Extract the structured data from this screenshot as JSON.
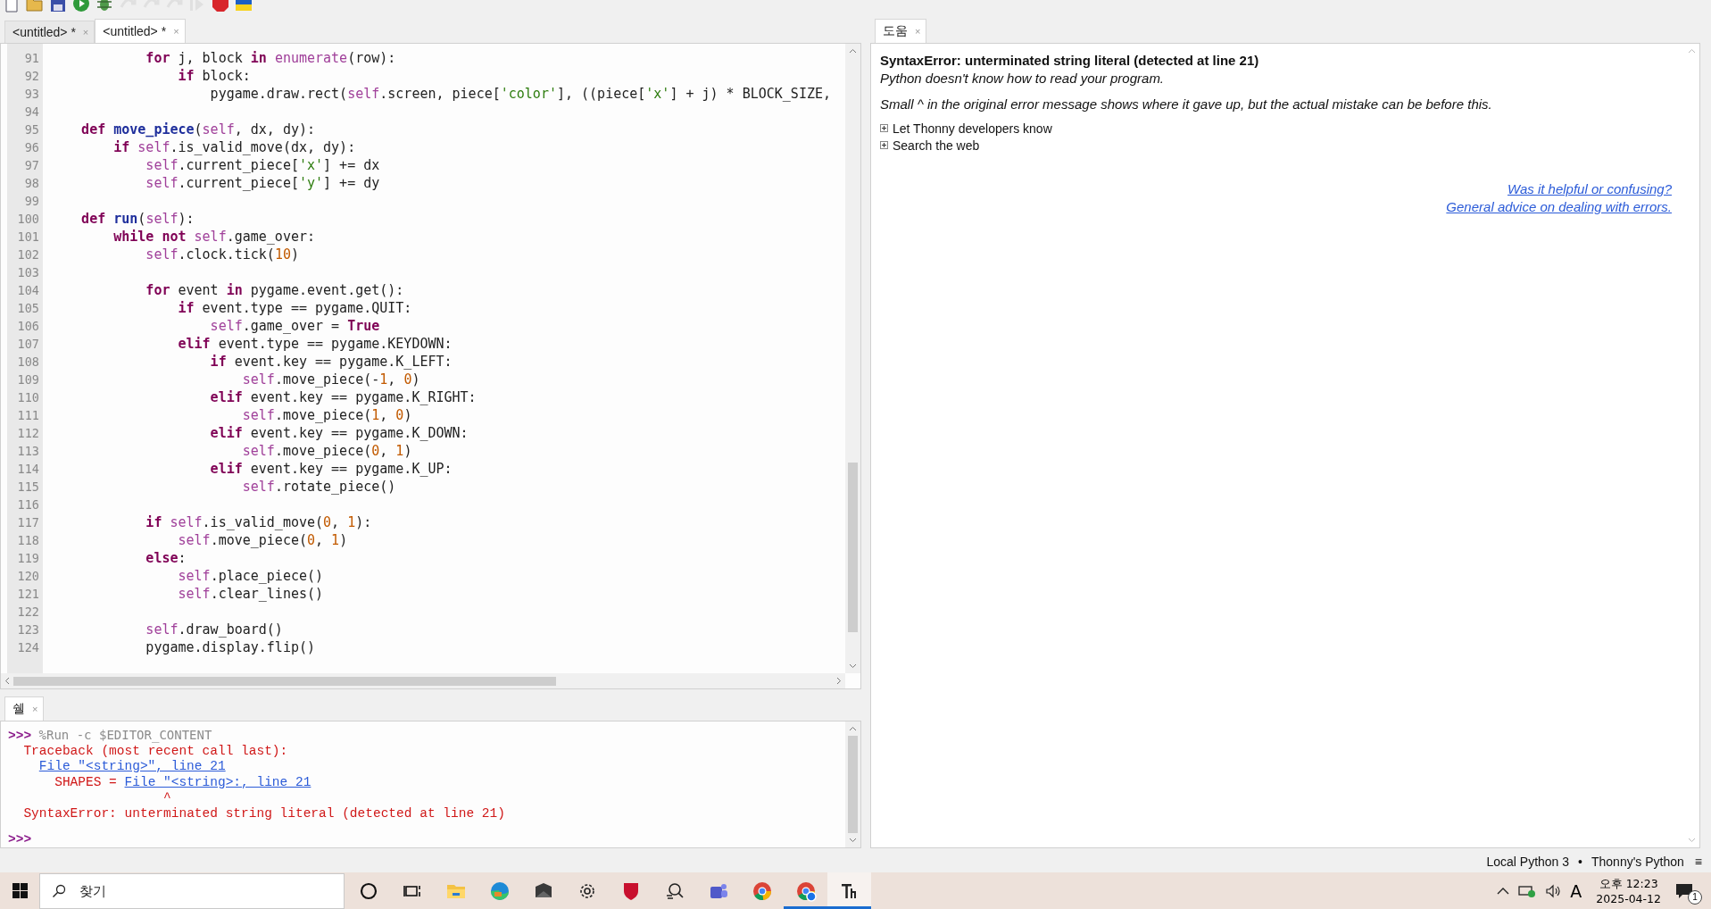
{
  "toolbar": {
    "buttons": [
      {
        "kind": "new",
        "disabled": false
      },
      {
        "kind": "open",
        "disabled": false
      },
      {
        "kind": "save",
        "disabled": false
      },
      {
        "kind": "run",
        "disabled": false
      },
      {
        "kind": "debug",
        "disabled": false
      },
      {
        "kind": "step_over",
        "disabled": true
      },
      {
        "kind": "step_into",
        "disabled": true
      },
      {
        "kind": "step_out",
        "disabled": true
      },
      {
        "kind": "resume",
        "disabled": true
      },
      {
        "kind": "stop",
        "disabled": false
      },
      {
        "kind": "flag",
        "disabled": false
      }
    ]
  },
  "editor": {
    "tabs": [
      {
        "label": "<untitled>",
        "marker": "*",
        "close": "×",
        "selected": false
      },
      {
        "label": "<untitled>",
        "marker": "*",
        "close": "×",
        "selected": true
      }
    ],
    "lines": [
      {
        "no": "91",
        "tokens": [
          {
            "kind": "kw",
            "text": "            for"
          },
          {
            "kind": "plain",
            "text": " j, block "
          },
          {
            "kind": "kw",
            "text": "in "
          },
          {
            "kind": "builtin",
            "text": "enumerate"
          },
          {
            "kind": "plain",
            "text": "(row):"
          }
        ]
      },
      {
        "no": "92",
        "tokens": [
          {
            "kind": "kw",
            "text": "                if"
          },
          {
            "kind": "plain",
            "text": " block:"
          }
        ]
      },
      {
        "no": "93",
        "tokens": [
          {
            "kind": "plain",
            "text": "                    pygame.draw.rect("
          },
          {
            "kind": "builtin",
            "text": "self"
          },
          {
            "kind": "plain",
            "text": ".screen, piece["
          },
          {
            "kind": "str",
            "text": "'color'"
          },
          {
            "kind": "plain",
            "text": "], ((piece["
          },
          {
            "kind": "str",
            "text": "'x'"
          },
          {
            "kind": "plain",
            "text": "] + j) * BLOCK_SIZE,"
          }
        ]
      },
      {
        "no": "94"
      },
      {
        "no": "95",
        "tokens": [
          {
            "kind": "kw",
            "text": "    def "
          },
          {
            "kind": "defname",
            "text": "move_piece"
          },
          {
            "kind": "plain",
            "text": "("
          },
          {
            "kind": "builtin",
            "text": "self"
          },
          {
            "kind": "plain",
            "text": ", dx, dy):"
          }
        ]
      },
      {
        "no": "96",
        "tokens": [
          {
            "kind": "kw",
            "text": "        if "
          },
          {
            "kind": "builtin",
            "text": "self"
          },
          {
            "kind": "plain",
            "text": ".is_valid_move(dx, dy):"
          }
        ]
      },
      {
        "no": "97",
        "tokens": [
          {
            "kind": "builtin",
            "text": "            self"
          },
          {
            "kind": "plain",
            "text": ".current_piece["
          },
          {
            "kind": "str",
            "text": "'x'"
          },
          {
            "kind": "plain",
            "text": "] += dx"
          }
        ]
      },
      {
        "no": "98",
        "tokens": [
          {
            "kind": "builtin",
            "text": "            self"
          },
          {
            "kind": "plain",
            "text": ".current_piece["
          },
          {
            "kind": "str",
            "text": "'y'"
          },
          {
            "kind": "plain",
            "text": "] += dy"
          }
        ]
      },
      {
        "no": "99"
      },
      {
        "no": "100",
        "tokens": [
          {
            "kind": "kw",
            "text": "    def "
          },
          {
            "kind": "defname",
            "text": "run"
          },
          {
            "kind": "plain",
            "text": "("
          },
          {
            "kind": "builtin",
            "text": "self"
          },
          {
            "kind": "plain",
            "text": "):"
          }
        ]
      },
      {
        "no": "101",
        "tokens": [
          {
            "kind": "kw",
            "text": "        while not "
          },
          {
            "kind": "builtin",
            "text": "self"
          },
          {
            "kind": "plain",
            "text": ".game_over:"
          }
        ]
      },
      {
        "no": "102",
        "tokens": [
          {
            "kind": "builtin",
            "text": "            self"
          },
          {
            "kind": "plain",
            "text": ".clock.tick("
          },
          {
            "kind": "num",
            "text": "10"
          },
          {
            "kind": "plain",
            "text": ")"
          }
        ]
      },
      {
        "no": "103"
      },
      {
        "no": "104",
        "tokens": [
          {
            "kind": "kw",
            "text": "            for"
          },
          {
            "kind": "plain",
            "text": " event "
          },
          {
            "kind": "kw",
            "text": "in"
          },
          {
            "kind": "plain",
            "text": " pygame.event.get():"
          }
        ]
      },
      {
        "no": "105",
        "tokens": [
          {
            "kind": "kw",
            "text": "                if"
          },
          {
            "kind": "plain",
            "text": " event.type == pygame.QUIT:"
          }
        ]
      },
      {
        "no": "106",
        "tokens": [
          {
            "kind": "builtin",
            "text": "                    self"
          },
          {
            "kind": "plain",
            "text": ".game_over = "
          },
          {
            "kind": "kw",
            "text": "True"
          }
        ]
      },
      {
        "no": "107",
        "tokens": [
          {
            "kind": "kw",
            "text": "                elif"
          },
          {
            "kind": "plain",
            "text": " event.type == pygame.KEYDOWN:"
          }
        ]
      },
      {
        "no": "108",
        "tokens": [
          {
            "kind": "kw",
            "text": "                    if"
          },
          {
            "kind": "plain",
            "text": " event.key == pygame.K_LEFT:"
          }
        ]
      },
      {
        "no": "109",
        "tokens": [
          {
            "kind": "builtin",
            "text": "                        self"
          },
          {
            "kind": "plain",
            "text": ".move_piece(-"
          },
          {
            "kind": "num",
            "text": "1"
          },
          {
            "kind": "plain",
            "text": ", "
          },
          {
            "kind": "num",
            "text": "0"
          },
          {
            "kind": "plain",
            "text": ")"
          }
        ]
      },
      {
        "no": "110",
        "tokens": [
          {
            "kind": "kw",
            "text": "                    elif"
          },
          {
            "kind": "plain",
            "text": " event.key == pygame.K_RIGHT:"
          }
        ]
      },
      {
        "no": "111",
        "tokens": [
          {
            "kind": "builtin",
            "text": "                        self"
          },
          {
            "kind": "plain",
            "text": ".move_piece("
          },
          {
            "kind": "num",
            "text": "1"
          },
          {
            "kind": "plain",
            "text": ", "
          },
          {
            "kind": "num",
            "text": "0"
          },
          {
            "kind": "plain",
            "text": ")"
          }
        ]
      },
      {
        "no": "112",
        "tokens": [
          {
            "kind": "kw",
            "text": "                    elif"
          },
          {
            "kind": "plain",
            "text": " event.key == pygame.K_DOWN:"
          }
        ]
      },
      {
        "no": "113",
        "tokens": [
          {
            "kind": "builtin",
            "text": "                        self"
          },
          {
            "kind": "plain",
            "text": ".move_piece("
          },
          {
            "kind": "num",
            "text": "0"
          },
          {
            "kind": "plain",
            "text": ", "
          },
          {
            "kind": "num",
            "text": "1"
          },
          {
            "kind": "plain",
            "text": ")"
          }
        ]
      },
      {
        "no": "114",
        "tokens": [
          {
            "kind": "kw",
            "text": "                    elif"
          },
          {
            "kind": "plain",
            "text": " event.key == pygame.K_UP:"
          }
        ]
      },
      {
        "no": "115",
        "tokens": [
          {
            "kind": "builtin",
            "text": "                        self"
          },
          {
            "kind": "plain",
            "text": ".rotate_piece()"
          }
        ]
      },
      {
        "no": "116"
      },
      {
        "no": "117",
        "tokens": [
          {
            "kind": "kw",
            "text": "            if "
          },
          {
            "kind": "builtin",
            "text": "self"
          },
          {
            "kind": "plain",
            "text": ".is_valid_move("
          },
          {
            "kind": "num",
            "text": "0"
          },
          {
            "kind": "plain",
            "text": ", "
          },
          {
            "kind": "num",
            "text": "1"
          },
          {
            "kind": "plain",
            "text": "):"
          }
        ]
      },
      {
        "no": "118",
        "tokens": [
          {
            "kind": "builtin",
            "text": "                self"
          },
          {
            "kind": "plain",
            "text": ".move_piece("
          },
          {
            "kind": "num",
            "text": "0"
          },
          {
            "kind": "plain",
            "text": ", "
          },
          {
            "kind": "num",
            "text": "1"
          },
          {
            "kind": "plain",
            "text": ")"
          }
        ]
      },
      {
        "no": "119",
        "tokens": [
          {
            "kind": "kw",
            "text": "            else"
          },
          {
            "kind": "plain",
            "text": ":"
          }
        ]
      },
      {
        "no": "120",
        "tokens": [
          {
            "kind": "builtin",
            "text": "                self"
          },
          {
            "kind": "plain",
            "text": ".place_piece()"
          }
        ]
      },
      {
        "no": "121",
        "tokens": [
          {
            "kind": "builtin",
            "text": "                self"
          },
          {
            "kind": "plain",
            "text": ".clear_lines()"
          }
        ]
      },
      {
        "no": "122"
      },
      {
        "no": "123",
        "tokens": [
          {
            "kind": "builtin",
            "text": "            self"
          },
          {
            "kind": "plain",
            "text": ".draw_board()"
          }
        ]
      },
      {
        "no": "124",
        "tokens": [
          {
            "kind": "plain",
            "text": "            pygame.display.flip()"
          }
        ]
      }
    ]
  },
  "shell": {
    "tab": {
      "label": "쉘",
      "close": "×"
    },
    "lines": [
      {
        "parts": [
          {
            "kind": "prompt",
            "text": ">>>"
          },
          {
            "kind": "command",
            "text": " %Run -c $EDITOR_CONTENT"
          }
        ]
      },
      {
        "parts": [
          {
            "kind": "error",
            "text": "  Traceback (most recent call last):"
          }
        ]
      },
      {
        "parts": [
          {
            "kind": "link",
            "text": "File \"<string>\", line 21"
          }
        ]
      },
      {
        "parts": [
          {
            "kind": "error",
            "text": "      SHAPES = "
          },
          {
            "kind": "link",
            "text": "File \"<string>:, line 21"
          }
        ]
      },
      {
        "parts": [
          {
            "kind": "error",
            "text": "                    ^"
          }
        ]
      },
      {
        "parts": [
          {
            "kind": "error",
            "text": "  SyntaxError: unterminated string literal (detected at line 21)"
          }
        ]
      },
      {
        "parts": [
          {
            "kind": "prompt",
            "text": ">>>"
          }
        ]
      }
    ]
  },
  "help": {
    "tab": {
      "label": "도움",
      "close": "×"
    },
    "title": "SyntaxError: unterminated string literal (detected at line 21)",
    "summary": "Python doesn't know how to read your program.",
    "hint": "Small ^ in the original error message shows where it gave up, but the actual mistake can be before this.",
    "sections": [
      {
        "label": "Let Thonny developers know",
        "expanded": false
      },
      {
        "label": "Search the web",
        "expanded": false
      }
    ],
    "links": [
      "Was it helpful or confusing?",
      "General advice on dealing with errors."
    ]
  },
  "status_bar": {
    "interpreter": "Local Python 3",
    "separator": "•",
    "backend": "Thonny's Python",
    "menu": "≡"
  },
  "taskbar": {
    "search": {
      "placeholder": "찾기"
    },
    "apps": [
      {
        "kind": "circle",
        "running": false,
        "selected": false
      },
      {
        "kind": "taskview",
        "running": false,
        "selected": false
      },
      {
        "kind": "folder",
        "running": false,
        "selected": false
      },
      {
        "kind": "swirl",
        "running": false,
        "selected": false
      },
      {
        "kind": "envelope",
        "running": false,
        "selected": false
      },
      {
        "kind": "gear",
        "running": false,
        "selected": false
      },
      {
        "kind": "shield",
        "running": false,
        "selected": false
      },
      {
        "kind": "magnifier",
        "running": false,
        "selected": false
      },
      {
        "kind": "people",
        "running": false,
        "selected": false
      },
      {
        "kind": "wheel",
        "running": false,
        "selected": false
      },
      {
        "kind": "wheel_badge",
        "running": true,
        "selected": false
      },
      {
        "kind": "monogram",
        "running": true,
        "selected": true
      }
    ],
    "tray": {
      "ime": "A",
      "time": "오후 12:23",
      "date": "2025-04-12",
      "notifications": "1"
    }
  }
}
